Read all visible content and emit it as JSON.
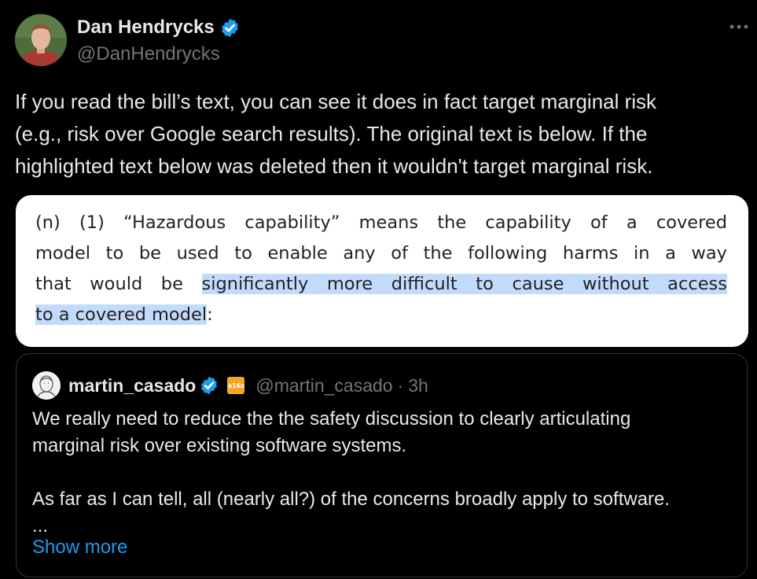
{
  "author": {
    "name": "Dan Hendrycks",
    "handle": "@DanHendrycks",
    "verified": true,
    "avatar_icon": "avatar-photo"
  },
  "menu": {
    "more_icon": "more-horizontal-icon"
  },
  "tweet": {
    "text_lines": [
      "If you read the bill’s text, you can see it does in fact target marginal risk",
      "(e.g., risk over Google search results). The original text is below. If the",
      "highlighted text below was deleted then it wouldn't target marginal risk."
    ]
  },
  "media": {
    "line1": "(n) (1) “Hazardous capability” means the capability of a covered",
    "line2": "model to be used to enable any of the following harms in a way",
    "line3_plain": "that would be ",
    "line3_highlight": "significantly more difficult to cause without access",
    "line4_highlight": "to a covered model",
    "line4_plain": ":",
    "highlight_color": "#c3dbfb"
  },
  "quote": {
    "name": "martin_casado",
    "verified": true,
    "org_badge": "a16z",
    "handle": "@martin_casado",
    "separator": "·",
    "time": "3h",
    "body_lines_1": [
      "We really need to reduce the the safety discussion to clearly articulating",
      "marginal risk over existing software systems."
    ],
    "body_lines_2": [
      "As far as I can tell, all (nearly all?) of the concerns broadly apply to software.",
      "..."
    ],
    "show_more": "Show more"
  },
  "colors": {
    "background": "#000000",
    "text_primary": "#e7e9ea",
    "text_secondary": "#71767b",
    "accent_blue": "#1d9bf0",
    "border": "#2f3336",
    "verified_badge": "#1d9bf0"
  }
}
